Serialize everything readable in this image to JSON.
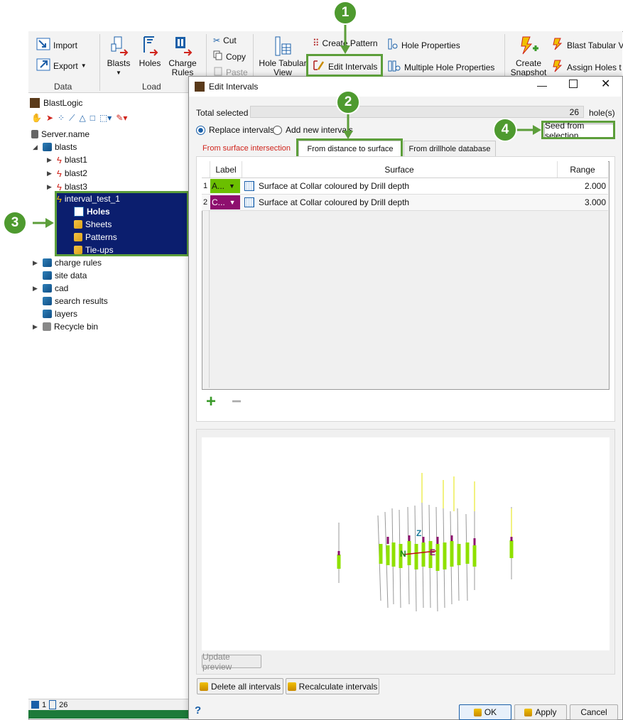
{
  "ribbon": {
    "import": "Import",
    "export": "Export",
    "group_data": "Data",
    "blasts": "Blasts",
    "holes": "Holes",
    "charge_rules": "Charge Rules",
    "group_load": "Load",
    "cut": "Cut",
    "copy": "Copy",
    "paste": "Paste",
    "hole_tabular_view": "Hole Tabular View",
    "create_pattern": "Create Pattern",
    "edit_intervals": "Edit Intervals",
    "hole_properties": "Hole Properties",
    "multiple_hole_properties": "Multiple Hole Properties",
    "create_snapshot": "Create Snapshot",
    "blast_tabular": "Blast Tabular V",
    "assign_holes": "Assign Holes t"
  },
  "left": {
    "app_title": "BlastLogic",
    "server": "Server.name",
    "blasts": "blasts",
    "blast1": "blast1",
    "blast2": "blast2",
    "blast3": "blast3",
    "interval_test": "interval_test_1",
    "holes": "Holes",
    "sheets": "Sheets",
    "patterns": "Patterns",
    "tieups": "Tie-ups",
    "charge_rules": "charge rules",
    "site_data": "site data",
    "cad": "cad",
    "search_results": "search results",
    "layers": "layers",
    "recycle_bin": "Recycle bin",
    "status_a": "1",
    "status_b": "26"
  },
  "dialog": {
    "title": "Edit Intervals",
    "total_selected_label": "Total selected",
    "total_selected_value": "26",
    "holes_unit": "hole(s)",
    "replace_intervals": "Replace intervals",
    "add_new_intervals": "Add new intervals",
    "seed_from_selection": "Seed from selection",
    "tabs": {
      "surface_intersection": "From surface intersection",
      "distance_to_surface": "From distance to surface",
      "drillhole_database": "From drillhole database"
    },
    "table": {
      "col_label": "Label",
      "col_surface": "Surface",
      "col_range": "Range",
      "rows": [
        {
          "num": "1",
          "label": "A...",
          "color": "#6bbf00",
          "surface": "Surface at Collar coloured by Drill depth",
          "range": "2.000"
        },
        {
          "num": "2",
          "label": "C...",
          "color": "#8e0f6e",
          "surface": "Surface at Collar coloured by Drill depth",
          "range": "3.000"
        }
      ]
    },
    "update_preview": "Update preview",
    "delete_all": "Delete all intervals",
    "recalculate": "Recalculate intervals",
    "ok": "OK",
    "apply": "Apply",
    "cancel": "Cancel",
    "help": "?"
  },
  "callouts": [
    "1",
    "2",
    "3",
    "4"
  ],
  "colors": {
    "accent_green": "#5c9e3a",
    "selection_navy": "#0b1e6e",
    "interval_green": "#8fe000",
    "interval_purple": "#8e0f6e"
  }
}
